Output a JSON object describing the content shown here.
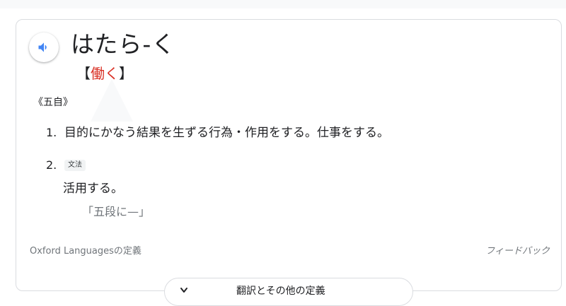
{
  "entry": {
    "headword": "はたら-く",
    "kanji_open": "【",
    "kanji": "働く",
    "kanji_close": "】",
    "part_of_speech": "《五自》"
  },
  "senses": [
    {
      "number": "1.",
      "definition": "目的にかなう結果を生ずる行為・作用をする。仕事をする。"
    },
    {
      "number": "2.",
      "tag": "文法",
      "definition": "活用する。",
      "example": "「五段に—」"
    }
  ],
  "footer": {
    "source": "Oxford Languagesの定義",
    "feedback": "フィードバック"
  },
  "more": {
    "label": "翻訳とその他の定義"
  },
  "colors": {
    "accent_blue": "#4285f4",
    "kanji_red": "#d93025"
  },
  "icons": {
    "speaker": "speaker-icon",
    "chevron": "chevron-down-icon"
  }
}
